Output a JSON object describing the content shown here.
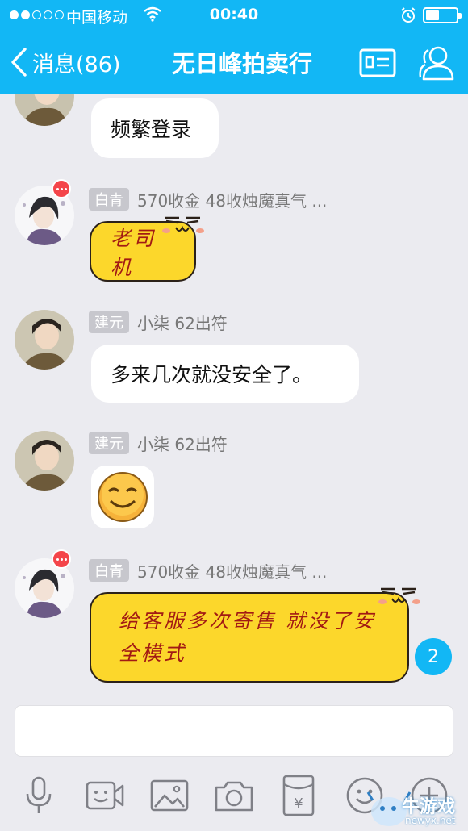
{
  "status_bar": {
    "carrier": "中国移动",
    "time": "00:40"
  },
  "nav": {
    "back_label": "消息(86)",
    "title": "无日峰拍卖行"
  },
  "messages": [
    {
      "text": "频繁登录"
    },
    {
      "tag": "白青",
      "nickname": "570收金 48收烛魔真气 ...",
      "text": "老司机"
    },
    {
      "tag": "建元",
      "nickname": "小柒  62出符",
      "text": "多来几次就没安全了。"
    },
    {
      "tag": "建元",
      "nickname": "小柒  62出符",
      "emoji": "smile-face"
    },
    {
      "tag": "白青",
      "nickname": "570收金 48收烛魔真气 ...",
      "text_line1": "给客服多次寄售 就没了安",
      "text_line2": "全模式"
    }
  ],
  "unread_count": "2",
  "toolbar": {
    "icons": [
      "microphone-icon",
      "video-call-icon",
      "image-icon",
      "camera-icon",
      "red-packet-icon",
      "emoji-icon",
      "plus-icon"
    ],
    "red_packet_symbol": "¥"
  },
  "watermark": {
    "text": "牛游戏",
    "url": "newyx.net"
  },
  "colors": {
    "brand_blue": "#12b7f5",
    "bubble_yellow": "#fcd72b",
    "yellow_text": "#a21a14",
    "background": "#ebebf0"
  }
}
